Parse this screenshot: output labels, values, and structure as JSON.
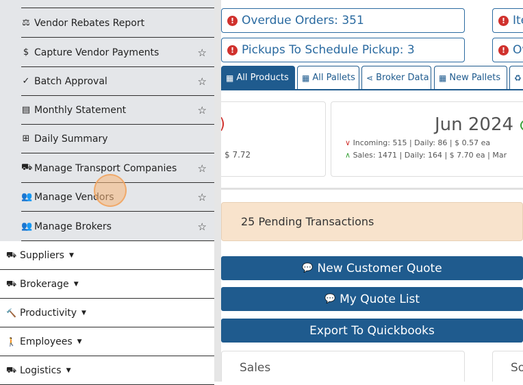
{
  "sidebar": {
    "submenu": [
      {
        "icon": "balance-scale-icon",
        "glyph": "⚖",
        "label": "Vendor Rebates Report",
        "star": false
      },
      {
        "icon": "dollar-icon",
        "glyph": "$",
        "label": "Capture Vendor Payments",
        "star": true
      },
      {
        "icon": "check-icon",
        "glyph": "✓",
        "label": "Batch Approval",
        "star": true
      },
      {
        "icon": "list-icon",
        "glyph": "▤",
        "label": "Monthly Statement",
        "star": true
      },
      {
        "icon": "table-icon",
        "glyph": "⊞",
        "label": "Daily Summary",
        "star": false
      },
      {
        "icon": "truck-icon",
        "glyph": "⛟",
        "label": "Manage Transport Companies",
        "star": true
      },
      {
        "icon": "users-icon",
        "glyph": "👥",
        "label": "Manage Vendors",
        "star": true
      },
      {
        "icon": "users-icon",
        "glyph": "👥",
        "label": "Manage Brokers",
        "star": true
      }
    ],
    "menu": [
      {
        "icon": "truck-loading-icon",
        "glyph": "⛟",
        "label": "Suppliers"
      },
      {
        "icon": "truck-icon",
        "glyph": "⛟",
        "label": "Brokerage"
      },
      {
        "icon": "hammer-icon",
        "glyph": "🔨",
        "label": "Productivity"
      },
      {
        "icon": "person-icon",
        "glyph": "🚶",
        "label": "Employees"
      },
      {
        "icon": "truck-icon",
        "glyph": "⛟",
        "label": "Logistics"
      }
    ],
    "star_glyph": "☆",
    "caret_glyph": "▼"
  },
  "alerts": [
    {
      "label": "Overdue Orders: 351"
    },
    {
      "label": "Ite"
    },
    {
      "label": "Pickups To Schedule Pickup: 3"
    },
    {
      "label": "Ov"
    }
  ],
  "tabs": [
    {
      "icon": "pallet-icon",
      "glyph": "▦",
      "label": "All Products",
      "active": true
    },
    {
      "icon": "pallet-icon",
      "glyph": "▦",
      "label": "All Pallets",
      "active": false
    },
    {
      "icon": "share-icon",
      "glyph": "⋖",
      "label": "Broker Data",
      "active": false
    },
    {
      "icon": "pallet-icon",
      "glyph": "▦",
      "label": "New Pallets",
      "active": false
    },
    {
      "icon": "recycle-icon",
      "glyph": "♻",
      "label": "",
      "active": false
    }
  ],
  "card_left": {
    "paren": ")",
    "value": "$ 7.72"
  },
  "card_month": {
    "title": "Jun 2024",
    "incoming": "Incoming: 515 | Daily: 86 | $ 0.57 ea",
    "sales": "Sales: 1471 | Daily: 164 | $ 7.70 ea | Mar"
  },
  "pending": "25 Pending Transactions",
  "buttons": [
    {
      "icon": "comment-dollar-icon",
      "glyph": "💬",
      "label": "New Customer Quote"
    },
    {
      "icon": "comment-dollar-icon",
      "glyph": "💬",
      "label": "My Quote List"
    },
    {
      "label": "Export To Quickbooks"
    }
  ],
  "panels": [
    {
      "label": "Sales"
    },
    {
      "label": "So"
    }
  ],
  "colors": {
    "primary": "#1f5b8e",
    "alert_red": "#d0312d",
    "pending_bg": "#f8e3cc",
    "sidebar_bg": "#e4e6e9"
  }
}
